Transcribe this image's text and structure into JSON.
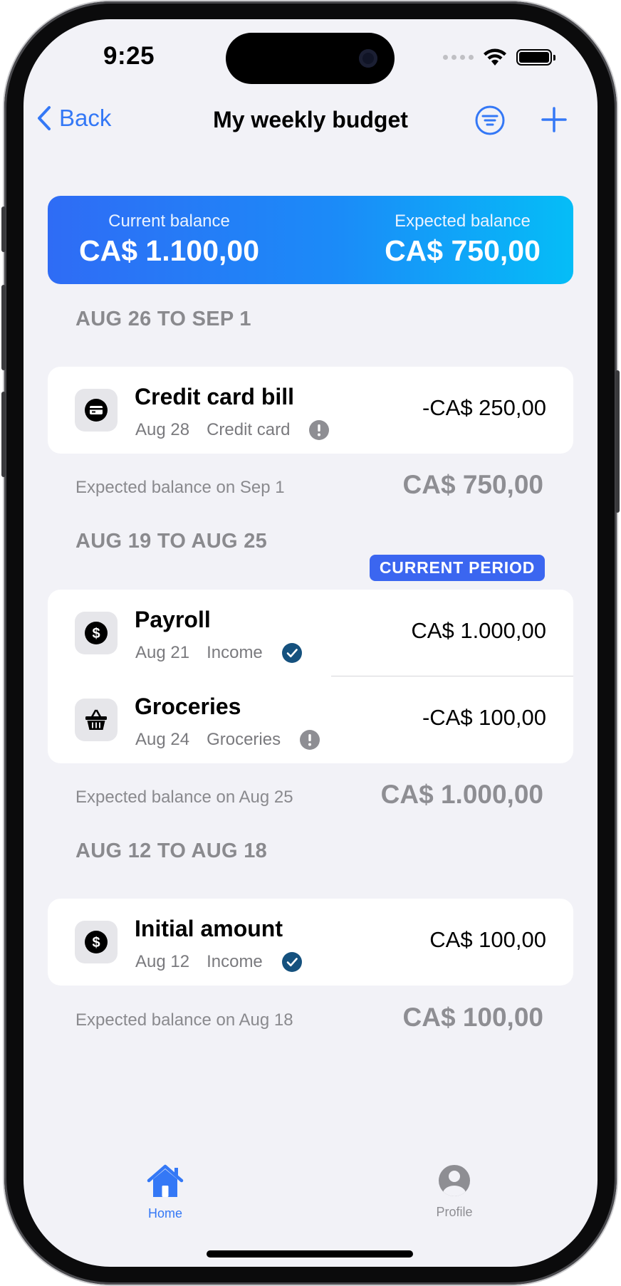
{
  "status_bar": {
    "time": "9:25"
  },
  "nav": {
    "back_label": "Back",
    "title": "My weekly budget",
    "filter_icon": "filter-icon",
    "add_icon": "plus-icon"
  },
  "balance": {
    "current_label": "Current balance",
    "current_value": "CA$ 1.100,00",
    "expected_label": "Expected balance",
    "expected_value": "CA$ 750,00"
  },
  "sections": [
    {
      "header": "AUG 26 TO SEP 1",
      "badge": "",
      "items": [
        {
          "icon": "credit-card-icon",
          "title": "Credit card bill",
          "date": "Aug 28",
          "category": "Credit card",
          "status": "pending",
          "amount": "-CA$ 250,00"
        }
      ],
      "footer_label": "Expected balance on Sep 1",
      "footer_value": "CA$ 750,00"
    },
    {
      "header": "AUG 19 TO AUG 25",
      "badge": "CURRENT PERIOD",
      "items": [
        {
          "icon": "dollar-icon",
          "title": "Payroll",
          "date": "Aug 21",
          "category": "Income",
          "status": "confirmed",
          "amount": "CA$ 1.000,00"
        },
        {
          "icon": "basket-icon",
          "title": "Groceries",
          "date": "Aug 24",
          "category": "Groceries",
          "status": "pending",
          "amount": "-CA$ 100,00"
        }
      ],
      "footer_label": "Expected balance on Aug 25",
      "footer_value": "CA$ 1.000,00"
    },
    {
      "header": "AUG 12 TO AUG 18",
      "badge": "",
      "items": [
        {
          "icon": "dollar-icon",
          "title": "Initial amount",
          "date": "Aug 12",
          "category": "Income",
          "status": "confirmed",
          "amount": "CA$ 100,00"
        }
      ],
      "footer_label": "Expected balance on Aug 18",
      "footer_value": "CA$ 100,00"
    }
  ],
  "tabs": [
    {
      "label": "Home",
      "icon": "home-icon",
      "active": true
    },
    {
      "label": "Profile",
      "icon": "profile-icon",
      "active": false
    }
  ],
  "colors": {
    "accent": "#3478f6",
    "badge": "#3b66f0",
    "check": "#15517e",
    "warning": "#8e8e93",
    "gradient_start": "#2f6cf5",
    "gradient_end": "#05bdf7"
  }
}
